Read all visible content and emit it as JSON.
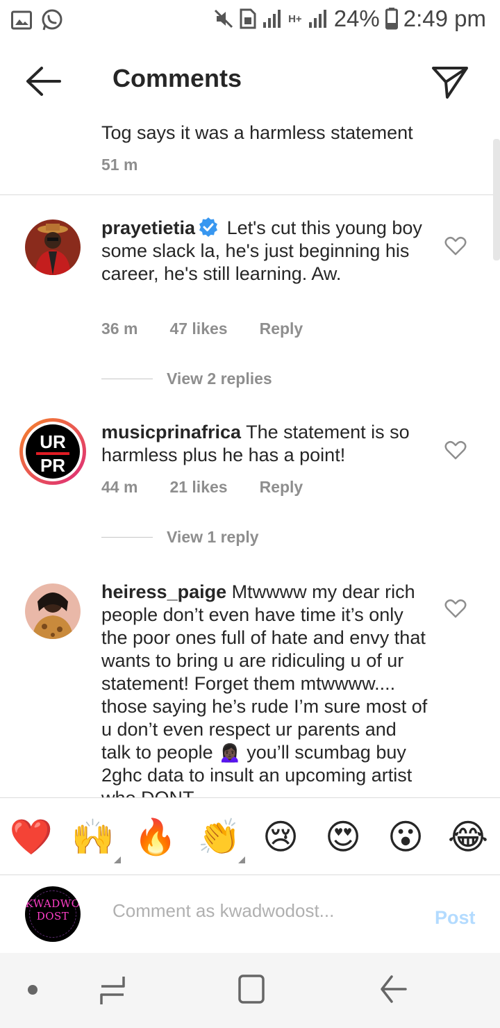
{
  "status_bar": {
    "battery": "24%",
    "time": "2:49 pm",
    "network": "H+",
    "icons": [
      "gallery-icon",
      "whatsapp-icon",
      "mute-icon",
      "sim-icon",
      "signal-icon",
      "signal-icon",
      "battery-icon"
    ]
  },
  "header": {
    "title": "Comments",
    "back_icon": "arrow-left-icon",
    "send_icon": "send-icon"
  },
  "caption": {
    "text": "Tog says it was a harmless statement",
    "time": "51 m"
  },
  "comments": [
    {
      "username": "prayetietia",
      "verified": true,
      "text": "Let's cut this young boy some slack la, he's just beginning his career, he's still learning. Aw.",
      "time": "36 m",
      "likes": "47 likes",
      "reply_label": "Reply",
      "view_replies": "View 2 replies"
    },
    {
      "username": "musicprinafrica",
      "verified": false,
      "text": "The statement is so harmless plus he has a point!",
      "time": "44 m",
      "likes": "21 likes",
      "reply_label": "Reply",
      "view_replies": "View 1 reply",
      "avatar_text_top": "UR",
      "avatar_text_bottom": "PR"
    },
    {
      "username": "heiress_paige",
      "verified": false,
      "text": "Mtwwww my dear rich people don’t even have time it’s only the poor ones full of hate and envy that wants to bring u are ridiculing u of ur statement! Forget them mtwwww.... those saying he’s rude I’m sure most of u don’t even respect ur parents and talk to people 🙍🏿‍♀️ you’ll scumbag buy 2ghc data to insult an upcoming artist who DONT"
    }
  ],
  "emoji_bar": [
    "❤️",
    "🙌",
    "🔥",
    "👏",
    "😢",
    "😍",
    "😮",
    "😂"
  ],
  "composer": {
    "avatar_text": "KWADWO DOST",
    "placeholder": "Comment as kwadwodost...",
    "post_label": "Post"
  },
  "nav": {
    "icons": [
      "dot-icon",
      "recents-icon",
      "home-icon",
      "back-icon"
    ]
  },
  "colors": {
    "verified": "#3897f0",
    "muted_text": "#8e8e8e",
    "post_disabled": "#b3dbff",
    "story_ring_start": "#f58529",
    "story_ring_end": "#dd2a7b"
  }
}
